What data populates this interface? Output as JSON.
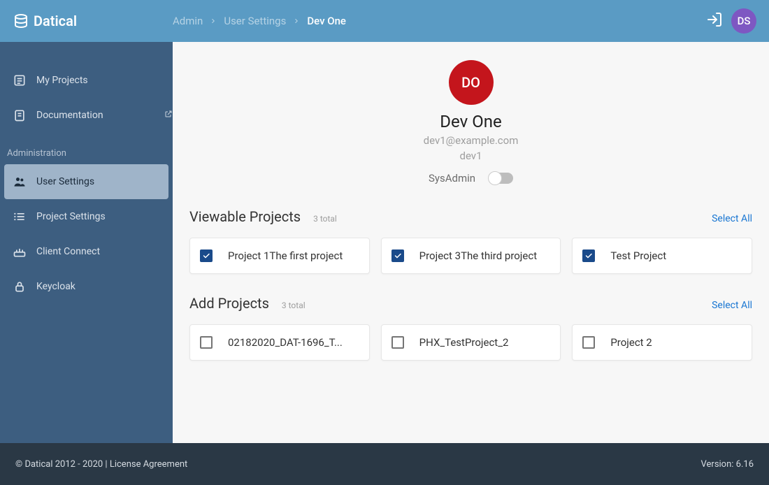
{
  "header": {
    "brand": "Datical",
    "breadcrumbs": [
      "Admin",
      "User Settings",
      "Dev One"
    ],
    "avatar_initials": "DS"
  },
  "sidebar": {
    "main": [
      {
        "label": "My Projects"
      },
      {
        "label": "Documentation",
        "external": true
      }
    ],
    "admin_header": "Administration",
    "admin": [
      {
        "label": "User Settings",
        "active": true
      },
      {
        "label": "Project Settings"
      },
      {
        "label": "Client Connect"
      },
      {
        "label": "Keycloak"
      }
    ]
  },
  "profile": {
    "avatar_initials": "DO",
    "name": "Dev One",
    "email": "dev1@example.com",
    "username": "dev1",
    "sysadmin_label": "SysAdmin",
    "sysadmin_on": false
  },
  "viewable": {
    "title": "Viewable Projects",
    "count_label": "3 total",
    "select_all": "Select All",
    "projects": [
      {
        "label": "Project 1The first project",
        "checked": true
      },
      {
        "label": "Project 3The third project",
        "checked": true
      },
      {
        "label": "Test Project",
        "checked": true
      }
    ]
  },
  "addable": {
    "title": "Add Projects",
    "count_label": "3 total",
    "select_all": "Select All",
    "projects": [
      {
        "label": "02182020_DAT-1696_T...",
        "checked": false
      },
      {
        "label": "PHX_TestProject_2",
        "checked": false
      },
      {
        "label": "Project 2",
        "checked": false
      }
    ]
  },
  "footer": {
    "copyright": "© Datical 2012 - 2020 | License Agreement",
    "version": "Version: 6.16"
  }
}
